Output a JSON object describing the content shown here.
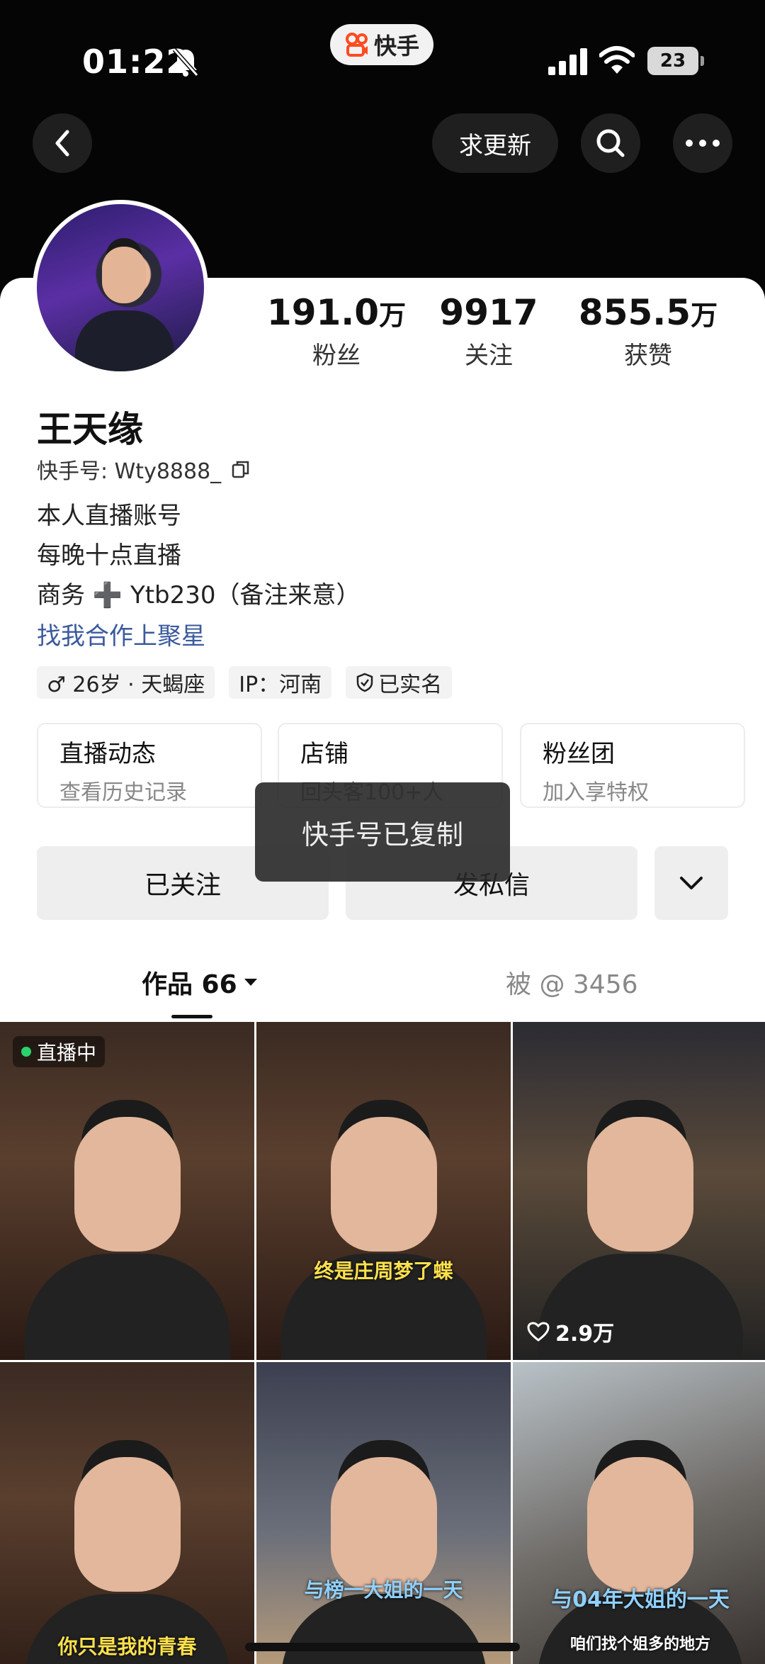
{
  "status": {
    "time": "01:22",
    "battery": "23"
  },
  "app_pill": {
    "label": "快手"
  },
  "nav": {
    "update_label": "求更新"
  },
  "profile": {
    "name": "王天缘",
    "kuaishou_id": "快手号: Wty8888_",
    "bio": [
      "本人直播账号",
      "每晚十点直播",
      "商务 ➕ Ytb230（备注来意）"
    ],
    "collab_link": "找我合作上聚星",
    "stats": [
      {
        "num": "191.0",
        "unit": "万",
        "label": "粉丝"
      },
      {
        "num": "9917",
        "unit": "",
        "label": "关注"
      },
      {
        "num": "855.5",
        "unit": "万",
        "label": "获赞"
      }
    ],
    "tags": [
      "♂ 26岁 · 天蝎座",
      "IP：河南",
      "已实名"
    ]
  },
  "features": [
    {
      "title": "直播动态",
      "sub": "查看历史记录"
    },
    {
      "title": "店铺",
      "sub": "回头客100+人"
    },
    {
      "title": "粉丝团",
      "sub": "加入享特权"
    }
  ],
  "toast": "快手号已复制",
  "actions": {
    "follow": "已关注",
    "message": "发私信"
  },
  "tabs": {
    "works": "作品 66",
    "mentions": "被 @ 3456"
  },
  "grid": {
    "live_badge": "直播中",
    "likes_3": "2.9万",
    "captions": {
      "c2": "终是庄周梦了蝶",
      "c4": "你只是我的青春",
      "c5": "与榜一大姐的一天",
      "c6a": "与04年大姐的一天",
      "c6b": "咱们找个姐多的地方"
    }
  }
}
